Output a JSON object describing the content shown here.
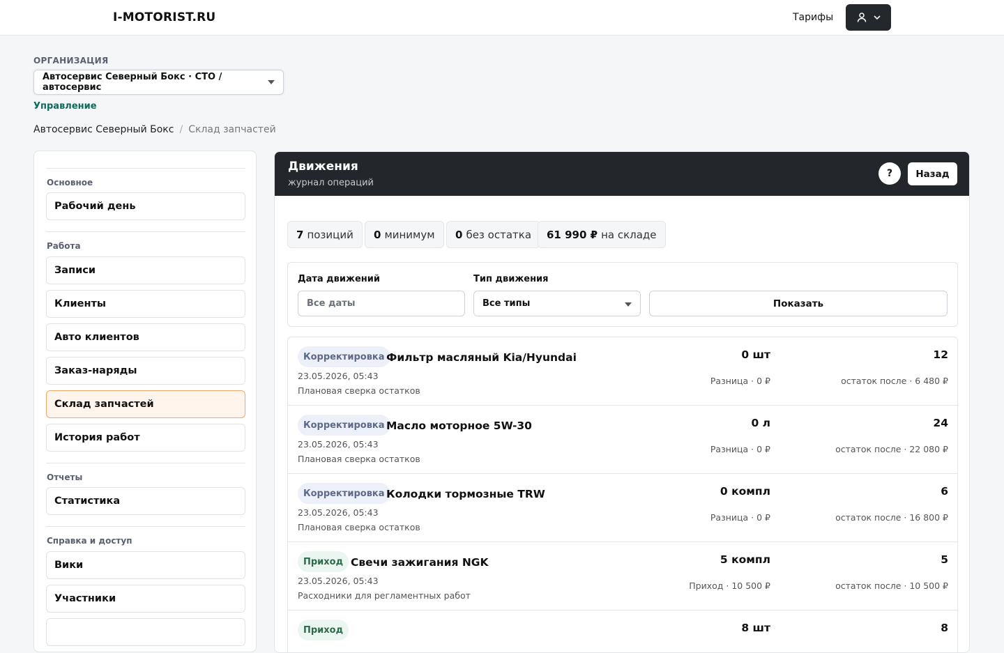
{
  "header": {
    "logo": "I-MOTORIST.RU",
    "tariffs_link": "Тарифы",
    "user_icon": "user-icon",
    "user_caret_icon": "chevron-down-icon"
  },
  "org": {
    "label": "ОРГАНИЗАЦИЯ",
    "selected": "Автосервис Северный Бокс · СТО / автосервис",
    "manage_link": "Управление"
  },
  "breadcrumb": {
    "root": "Автосервис Северный Бокс",
    "separator": "/",
    "current": "Склад запчастей"
  },
  "sidebar": {
    "groups": [
      {
        "title": "Основное",
        "items": [
          {
            "label": "Рабочий день"
          }
        ]
      },
      {
        "title": "Работа",
        "items": [
          {
            "label": "Записи"
          },
          {
            "label": "Клиенты"
          },
          {
            "label": "Авто клиентов"
          },
          {
            "label": "Заказ-наряды"
          },
          {
            "label": "Склад запчастей",
            "active": true
          },
          {
            "label": "История работ"
          }
        ]
      },
      {
        "title": "Отчеты",
        "items": [
          {
            "label": "Статистика"
          }
        ]
      },
      {
        "title": "Справка и доступ",
        "items": [
          {
            "label": "Вики"
          },
          {
            "label": "Участники"
          }
        ]
      }
    ]
  },
  "panel": {
    "title": "Движения",
    "subtitle": "журнал операций",
    "help_label": "?",
    "back_label": "Назад"
  },
  "stats": [
    {
      "value": "7",
      "label": "позиций"
    },
    {
      "value": "0",
      "label": "минимум"
    },
    {
      "value": "0",
      "label": "без остатка"
    },
    {
      "value": "61 990 ₽",
      "label": "на складе"
    }
  ],
  "filters": {
    "date_label": "Дата движений",
    "date_placeholder": "Все даты",
    "type_label": "Тип движения",
    "type_selected": "Все типы",
    "show_label": "Показать"
  },
  "movements": [
    {
      "type": "Корректировка",
      "kind": "adjust",
      "name": "Фильтр масляный Kia/Hyundai",
      "date": "23.05.2026, 05:43",
      "note": "Плановая сверка остатков",
      "qty": "0 шт",
      "diff": "Разница · 0 ₽",
      "stock": "12",
      "after": "остаток после · 6 480 ₽"
    },
    {
      "type": "Корректировка",
      "kind": "adjust",
      "name": "Масло моторное 5W-30",
      "date": "23.05.2026, 05:43",
      "note": "Плановая сверка остатков",
      "qty": "0 л",
      "diff": "Разница · 0 ₽",
      "stock": "24",
      "after": "остаток после · 22 080 ₽"
    },
    {
      "type": "Корректировка",
      "kind": "adjust",
      "name": "Колодки тормозные TRW",
      "date": "23.05.2026, 05:43",
      "note": "Плановая сверка остатков",
      "qty": "0 компл",
      "diff": "Разница · 0 ₽",
      "stock": "6",
      "after": "остаток после · 16 800 ₽"
    },
    {
      "type": "Приход",
      "kind": "income",
      "name": "Свечи зажигания NGK",
      "date": "23.05.2026, 05:43",
      "note": "Расходники для регламентных работ",
      "qty": "5 компл",
      "diff": "Приход · 10 500 ₽",
      "stock": "5",
      "after": "остаток после · 10 500 ₽"
    },
    {
      "type": "Приход",
      "kind": "income",
      "name": "",
      "date": "",
      "note": "",
      "qty": "8 шт",
      "diff": "",
      "stock": "8",
      "after": ""
    }
  ]
}
